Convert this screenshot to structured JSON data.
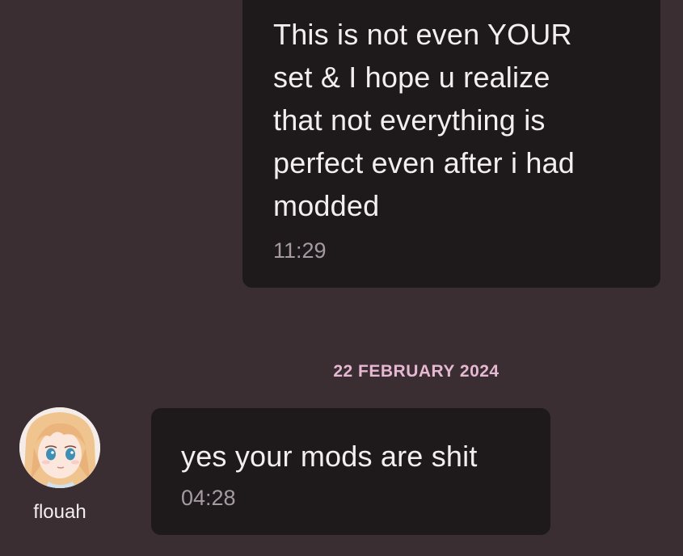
{
  "messages": {
    "outgoing": {
      "lines": [
        "This is not even YOUR",
        "set & I hope u realize",
        "that not everything is",
        "perfect even after i had",
        "modded"
      ],
      "time": "11:29"
    },
    "date_separator": "22 FEBRUARY 2024",
    "incoming": {
      "sender": "flouah",
      "text": "yes your mods are shit",
      "time": "04:28"
    }
  },
  "colors": {
    "background": "#3a2e33",
    "bubble": "#1e1a1c",
    "date_accent": "#e6b8d2",
    "timestamp": "#a59aa0"
  }
}
